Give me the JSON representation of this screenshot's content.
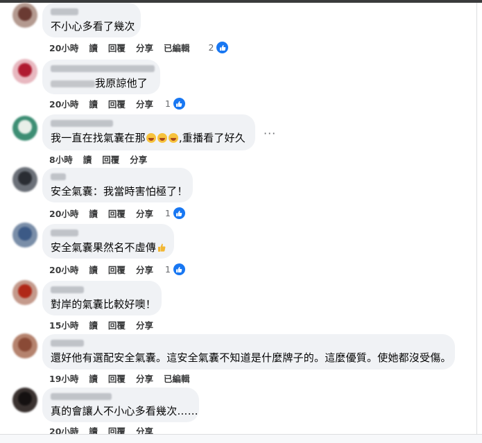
{
  "actions": {
    "read": "讀",
    "reply": "回覆",
    "share": "分享",
    "edited": "已編輯"
  },
  "comments": [
    {
      "text": "不小心多看了幾次",
      "time": "20小時",
      "edited": true,
      "likes": "2"
    },
    {
      "text": "我原諒他了",
      "time": "20小時",
      "edited": false,
      "likes": "1"
    },
    {
      "text_before": "我一直在找氣囊在那",
      "text_after": ",重播看了好久",
      "emoji": [
        "rofl-emoji",
        "rofl-emoji",
        "rofl-emoji"
      ],
      "time": "8小時",
      "edited": false,
      "likes": ""
    },
    {
      "text": "安全氣囊：我當時害怕極了！",
      "time": "20小時",
      "edited": false,
      "likes": "1"
    },
    {
      "text": "安全氣囊果然名不虛傳",
      "emoji": [
        "thumbs-up-emoji"
      ],
      "time": "20小時",
      "edited": false,
      "likes": "1"
    },
    {
      "text": "對岸的氣囊比較好噢！",
      "time": "15小時",
      "edited": false,
      "likes": ""
    },
    {
      "text": "還好他有選配安全氣囊。這安全氣囊不知道是什麼牌子的。這麼優質。使她都沒受傷。",
      "time": "19小時",
      "edited": true,
      "likes": ""
    },
    {
      "text": "真的會讓人不小心多看幾次……",
      "time": "20小時",
      "edited": false,
      "likes": ""
    }
  ],
  "colors": {
    "bubble": "#f0f2f5",
    "like_blue": "#1877f2",
    "meta_text": "#3a3b3c"
  },
  "icons": [
    "like-icon",
    "more-options-icon"
  ]
}
